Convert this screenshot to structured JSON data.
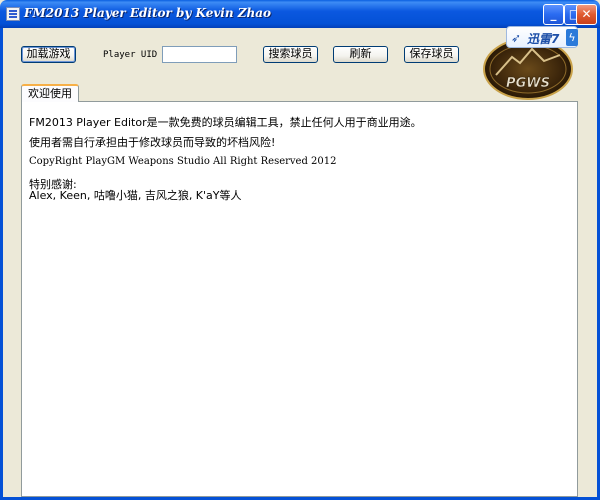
{
  "window": {
    "title": "FM2013 Player Editor by Kevin Zhao",
    "min_glyph": "_",
    "max_glyph": "□",
    "close_glyph": "✕"
  },
  "toolbar": {
    "load_label": "加载游戏",
    "uid_label": "Player UID",
    "uid_value": "",
    "search_label": "搜索球员",
    "refresh_label": "刷新",
    "save_label": "保存球员"
  },
  "logo": {
    "text": "PGWS",
    "badge_text": "迅雷7",
    "badge_bolt": "ϟ",
    "badge_bird": "➶"
  },
  "tabs": [
    {
      "label": "欢迎使用"
    }
  ],
  "welcome": {
    "line1": "FM2013 Player Editor是一款免费的球员编辑工具，禁止任何人用于商业用途。",
    "line2": "使用者需自行承担由于修改球员而导致的坏档风险!",
    "line3": "CopyRight PlayGM Weapons Studio All Right Reserved 2012",
    "line4": "特别感谢:",
    "line5": "Alex, Keen, 咕噜小猫, 吉风之狼, K'aY等人"
  }
}
